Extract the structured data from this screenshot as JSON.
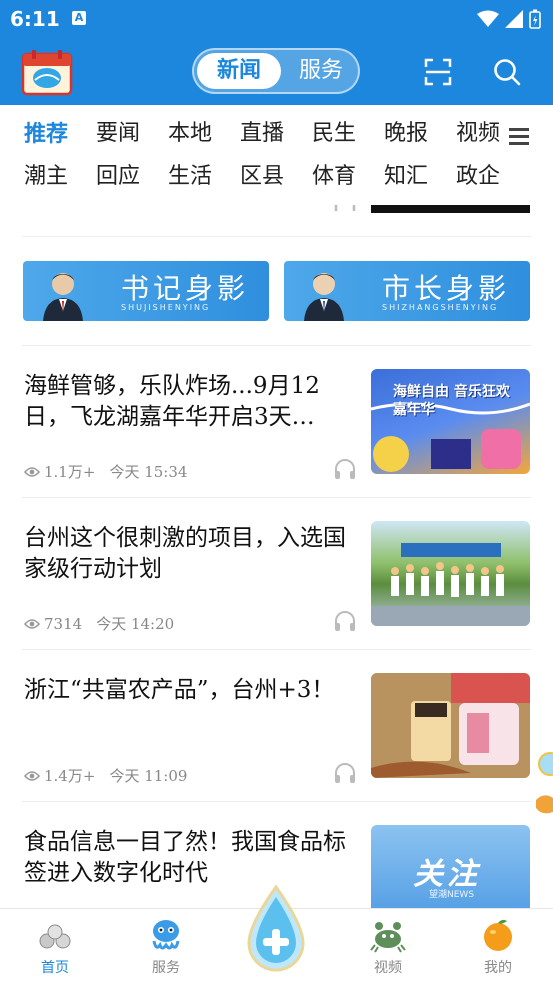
{
  "status_bar": {
    "time": "6:11",
    "a_badge": "A"
  },
  "header": {
    "segments": [
      "新闻",
      "服务"
    ],
    "active_segment": "新闻",
    "scan_icon": "scan-icon",
    "search_icon": "search-icon",
    "accent": "#1c87dc"
  },
  "channels": {
    "row1": [
      "推荐",
      "要闻",
      "本地",
      "直播",
      "民生",
      "晚报",
      "视频"
    ],
    "row2": [
      "潮主",
      "回应",
      "生活",
      "区县",
      "体育",
      "知汇",
      "政企"
    ],
    "active": "推荐"
  },
  "banners": [
    {
      "title": "书记身影",
      "pinyin": "SHUJISHENYING"
    },
    {
      "title": "市长身影",
      "pinyin": "SHIZHANGSHENYING"
    }
  ],
  "news": [
    {
      "title": "海鲜管够，乐队炸场...9月12日，飞龙湖嘉年华开启3天…",
      "views": "1.1万+",
      "date": "今天 15:34",
      "thumb_text": "海鲜自由 音乐狂欢嘉年华"
    },
    {
      "title": "台州这个很刺激的项目，入选国家级行动计划",
      "views": "7314",
      "date": "今天 14:20"
    },
    {
      "title": "浙江“共富农产品”，台州+3！",
      "views": "1.4万+",
      "date": "今天 11:09"
    },
    {
      "title": "食品信息一目了然！我国食品标签进入数字化时代",
      "thumb_text": "关注",
      "thumb_sub": "望潮NEWS"
    }
  ],
  "bottom_nav": [
    {
      "label": "首页",
      "icon": "home-icon",
      "active": true
    },
    {
      "label": "服务",
      "icon": "service-icon",
      "active": false
    },
    {
      "label": "",
      "icon": "center-plus-icon",
      "active": false
    },
    {
      "label": "视频",
      "icon": "video-crab-icon",
      "active": false
    },
    {
      "label": "我的",
      "icon": "profile-orange-icon",
      "active": false
    }
  ]
}
